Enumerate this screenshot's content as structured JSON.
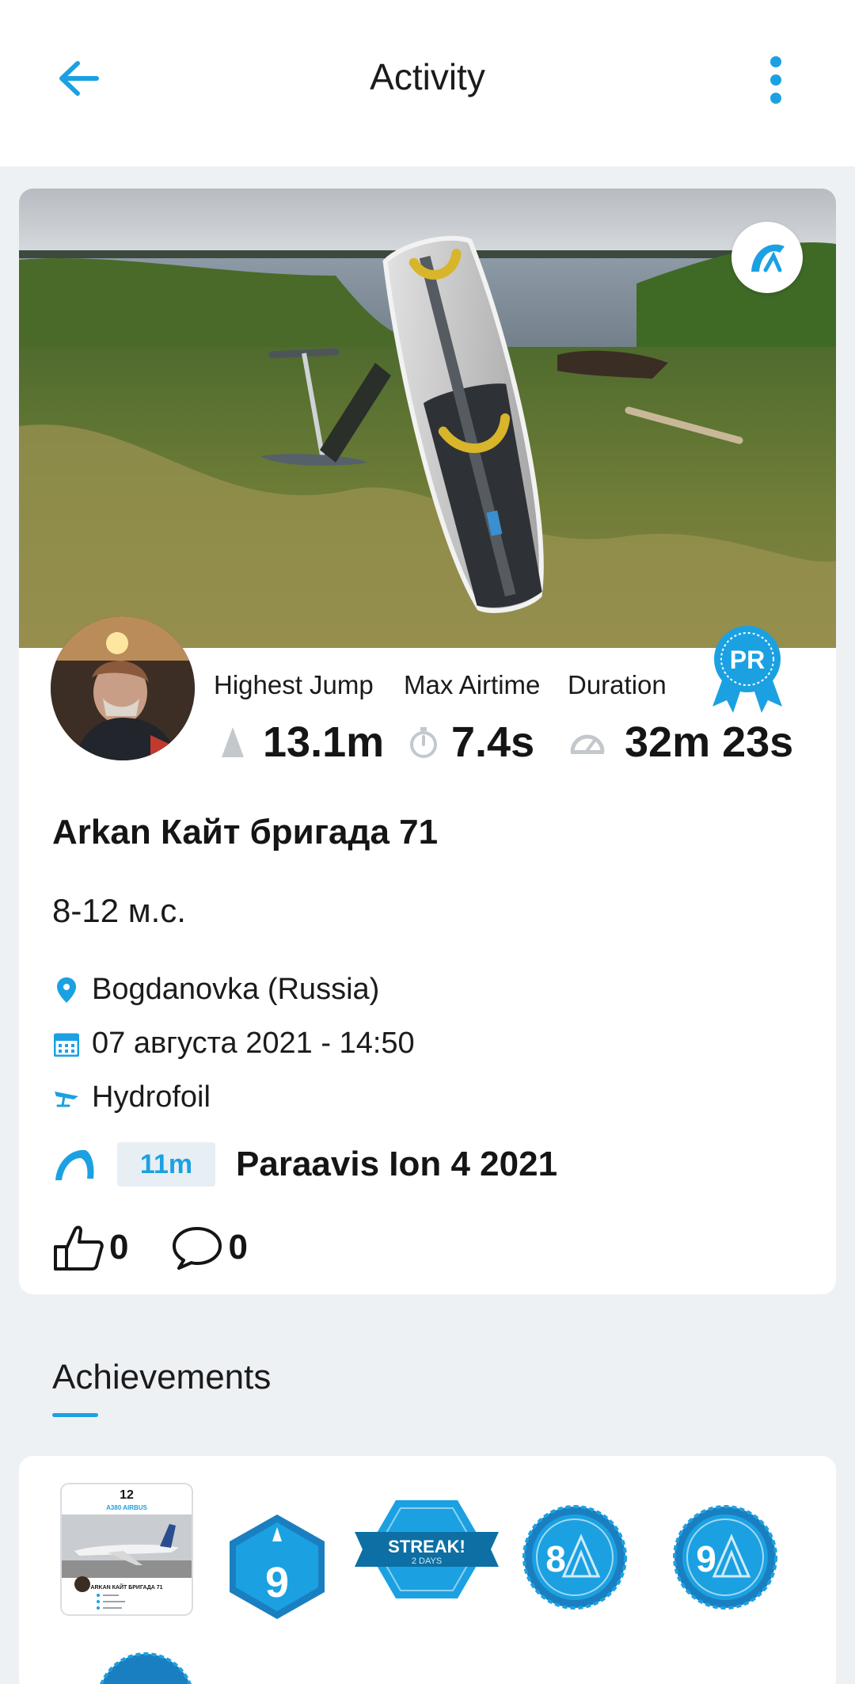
{
  "header": {
    "title": "Activity",
    "back_icon": "arrow-left-icon",
    "more_icon": "vertical-dots-icon"
  },
  "colors": {
    "accent": "#1ba1e2",
    "background": "#eef1f4",
    "card": "#ffffff",
    "text": "#151515",
    "pill_bg": "#e7eff5"
  },
  "activity": {
    "stats": [
      {
        "label": "Highest Jump",
        "value": "13.1m",
        "icon": "jump-icon"
      },
      {
        "label": "Max Airtime",
        "value": "7.4s",
        "icon": "stopwatch-icon"
      },
      {
        "label": "Duration",
        "value": "32m 23s",
        "icon": "speedometer-icon"
      }
    ],
    "pr_badge": "PR",
    "title": "Arkan Кайт бригада 71",
    "description": "8-12 м.с.",
    "location": "Bogdanovka (Russia)",
    "date": "07 августа 2021 - 14:50",
    "sport": "Hydrofoil",
    "gear": {
      "size": "11m",
      "name": "Paraavis Ion 4 2021"
    },
    "likes": "0",
    "comments": "0"
  },
  "achievements": {
    "title": "Achievements",
    "items": [
      {
        "type": "airplane-card",
        "rank": "12",
        "heading": "A380 AIRBUS",
        "title": "ARKAN КАЙТ БРИГАДА 71"
      },
      {
        "type": "hexagon-badge",
        "value": "9"
      },
      {
        "type": "streak-badge",
        "label": "STREAK!",
        "sub": "2 DAYS"
      },
      {
        "type": "seal-badge",
        "value": "8"
      },
      {
        "type": "seal-badge",
        "value": "9"
      }
    ]
  }
}
